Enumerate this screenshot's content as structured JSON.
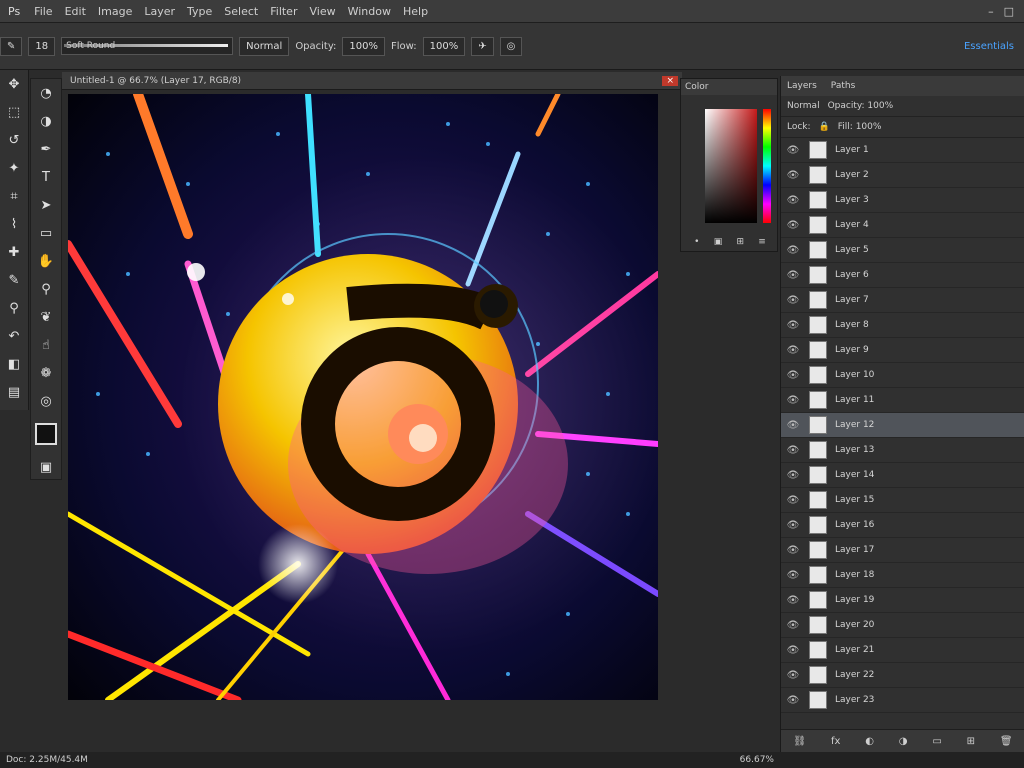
{
  "menubar": {
    "app_label": "Ps",
    "items": [
      "File",
      "Edit",
      "Image",
      "Layer",
      "Type",
      "Select",
      "Filter",
      "View",
      "Window",
      "Help"
    ],
    "right_icons": [
      "minimize-icon",
      "maximize-icon"
    ]
  },
  "options": {
    "tool_size": "18",
    "brush_preset_label": "Soft Round",
    "opacity_label": "Opacity:",
    "opacity_value": "100%",
    "flow_label": "Flow:",
    "flow_value": "100%",
    "mode_label": "Normal",
    "workspace_label": "Essentials"
  },
  "document": {
    "tab_title": "Untitled-1 @ 66.7% (Layer 17, RGB/8)",
    "close_label": "×"
  },
  "color_panel": {
    "title": "Color",
    "foot_icons": [
      "•",
      "▣",
      "⊞",
      "≡"
    ]
  },
  "layers": {
    "tabs": [
      "Layers",
      "Paths"
    ],
    "blend_mode": "Normal",
    "opacity_label": "Opacity: 100%",
    "lock_label": "Lock:",
    "fill_label": "Fill: 100%",
    "selected_index": 11,
    "items": [
      "Layer 1",
      "Layer 2",
      "Layer 3",
      "Layer 4",
      "Layer 5",
      "Layer 6",
      "Layer 7",
      "Layer 8",
      "Layer 9",
      "Layer 10",
      "Layer 11",
      "Layer 12",
      "Layer 13",
      "Layer 14",
      "Layer 15",
      "Layer 16",
      "Layer 17",
      "Layer 18",
      "Layer 19",
      "Layer 20",
      "Layer 21",
      "Layer 22",
      "Layer 23"
    ],
    "bottom_icons": [
      "link-icon",
      "fx-icon",
      "mask-icon",
      "adjustment-icon",
      "group-icon",
      "new-layer-icon",
      "trash-icon"
    ]
  },
  "status": {
    "doc_info": "Doc: 2.25M/45.4M",
    "zoom": "66.67%"
  },
  "colors": {
    "panel_bg": "#303030",
    "selection": "#50545a",
    "accent": "#4aa3ff"
  }
}
